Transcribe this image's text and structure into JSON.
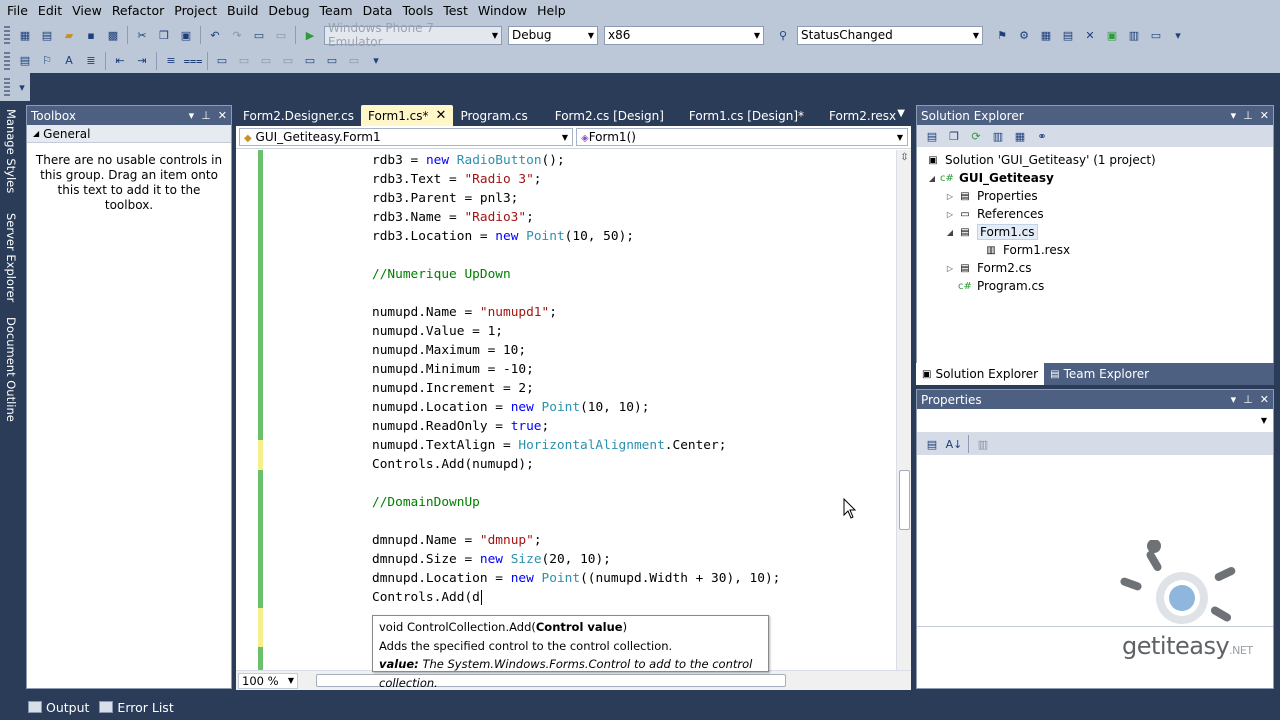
{
  "menu": [
    "File",
    "Edit",
    "View",
    "Refactor",
    "Project",
    "Build",
    "Debug",
    "Team",
    "Data",
    "Tools",
    "Test",
    "Window",
    "Help"
  ],
  "toolbar": {
    "target_device": "Windows Phone 7 Emulator",
    "configuration": "Debug",
    "platform": "x86",
    "find_text": "StatusChanged"
  },
  "left_strip": {
    "manage_styles": "Manage Styles",
    "server_explorer": "Server Explorer",
    "document_outline": "Document Outline"
  },
  "toolbox": {
    "title": "Toolbox",
    "group": "General",
    "empty_message": "There are no usable controls in this group. Drag an item onto this text to add it to the toolbox."
  },
  "editor": {
    "tabs": [
      {
        "label": "Form2.Designer.cs",
        "active": false
      },
      {
        "label": "Form1.cs*",
        "active": true
      },
      {
        "label": "Program.cs",
        "active": false
      },
      {
        "label": "Form2.cs [Design]",
        "active": false
      },
      {
        "label": "Form1.cs [Design]*",
        "active": false
      },
      {
        "label": "Form2.resx",
        "active": false
      }
    ],
    "class_combo": "GUI_Getiteasy.Form1",
    "member_combo": "Form1()",
    "zoom": "100 %",
    "code_lines": [
      [
        [
          "",
          "rdb3 = "
        ],
        [
          "kw",
          "new"
        ],
        [
          "",
          " "
        ],
        [
          "tp",
          "RadioButton"
        ],
        [
          "",
          "();"
        ]
      ],
      [
        [
          "",
          "rdb3.Text = "
        ],
        [
          "st",
          "\"Radio 3\""
        ],
        [
          "",
          ";"
        ]
      ],
      [
        [
          "",
          "rdb3.Parent = pnl3;"
        ]
      ],
      [
        [
          "",
          "rdb3.Name = "
        ],
        [
          "st",
          "\"Radio3\""
        ],
        [
          "",
          ";"
        ]
      ],
      [
        [
          "",
          "rdb3.Location = "
        ],
        [
          "kw",
          "new"
        ],
        [
          "",
          " "
        ],
        [
          "tp",
          "Point"
        ],
        [
          "",
          "(10, 50);"
        ]
      ],
      [],
      [
        [
          "cm",
          "//Numerique UpDown"
        ]
      ],
      [],
      [
        [
          "",
          "numupd.Name = "
        ],
        [
          "st",
          "\"numupd1\""
        ],
        [
          "",
          ";"
        ]
      ],
      [
        [
          "",
          "numupd.Value = 1;"
        ]
      ],
      [
        [
          "",
          "numupd.Maximum = 10;"
        ]
      ],
      [
        [
          "",
          "numupd.Minimum = -10;"
        ]
      ],
      [
        [
          "",
          "numupd.Increment = 2;"
        ]
      ],
      [
        [
          "",
          "numupd.Location = "
        ],
        [
          "kw",
          "new"
        ],
        [
          "",
          " "
        ],
        [
          "tp",
          "Point"
        ],
        [
          "",
          "(10, 10);"
        ]
      ],
      [
        [
          "",
          "numupd.ReadOnly = "
        ],
        [
          "kw",
          "true"
        ],
        [
          "",
          ";"
        ]
      ],
      [
        [
          "",
          "numupd.TextAlign = "
        ],
        [
          "tp",
          "HorizontalAlignment"
        ],
        [
          "",
          ".Center;"
        ]
      ],
      [
        [
          "",
          "Controls.Add(numupd);"
        ]
      ],
      [],
      [
        [
          "cm",
          "//DomainDownUp"
        ]
      ],
      [],
      [
        [
          "",
          "dmnupd.Name = "
        ],
        [
          "st",
          "\"dmnup\""
        ],
        [
          "",
          ";"
        ]
      ],
      [
        [
          "",
          "dmnupd.Size = "
        ],
        [
          "kw",
          "new"
        ],
        [
          "",
          " "
        ],
        [
          "tp",
          "Size"
        ],
        [
          "",
          "(20, 10);"
        ]
      ],
      [
        [
          "",
          "dmnupd.Location = "
        ],
        [
          "kw",
          "new"
        ],
        [
          "",
          " "
        ],
        [
          "tp",
          "Point"
        ],
        [
          "",
          "((numupd.Width + 30), 10);"
        ]
      ],
      [
        [
          "",
          "Controls.Add(d"
        ]
      ]
    ]
  },
  "tooltip": {
    "sig_prefix": "void ControlCollection.Add(",
    "sig_param": "Control value",
    "sig_suffix": ")",
    "description": "Adds the specified control to the control collection.",
    "param_name": "value:",
    "param_desc": "The System.Windows.Forms.Control to add to the control collection."
  },
  "solution_explorer": {
    "title": "Solution Explorer",
    "items": [
      {
        "label": "Solution 'GUI_Getiteasy' (1 project)",
        "bold": false
      },
      {
        "label": "GUI_Getiteasy",
        "bold": true
      },
      {
        "label": "Properties",
        "bold": false
      },
      {
        "label": "References",
        "bold": false
      },
      {
        "label": "Form1.cs",
        "bold": false
      },
      {
        "label": "Form1.resx",
        "bold": false
      },
      {
        "label": "Form2.cs",
        "bold": false
      },
      {
        "label": "Program.cs",
        "bold": false
      }
    ],
    "tabs": [
      "Solution Explorer",
      "Team Explorer"
    ]
  },
  "properties": {
    "title": "Properties"
  },
  "logo": {
    "text": "getiteasy",
    "suffix": ".NET"
  },
  "bottom_tabs": [
    "Output",
    "Error List"
  ]
}
